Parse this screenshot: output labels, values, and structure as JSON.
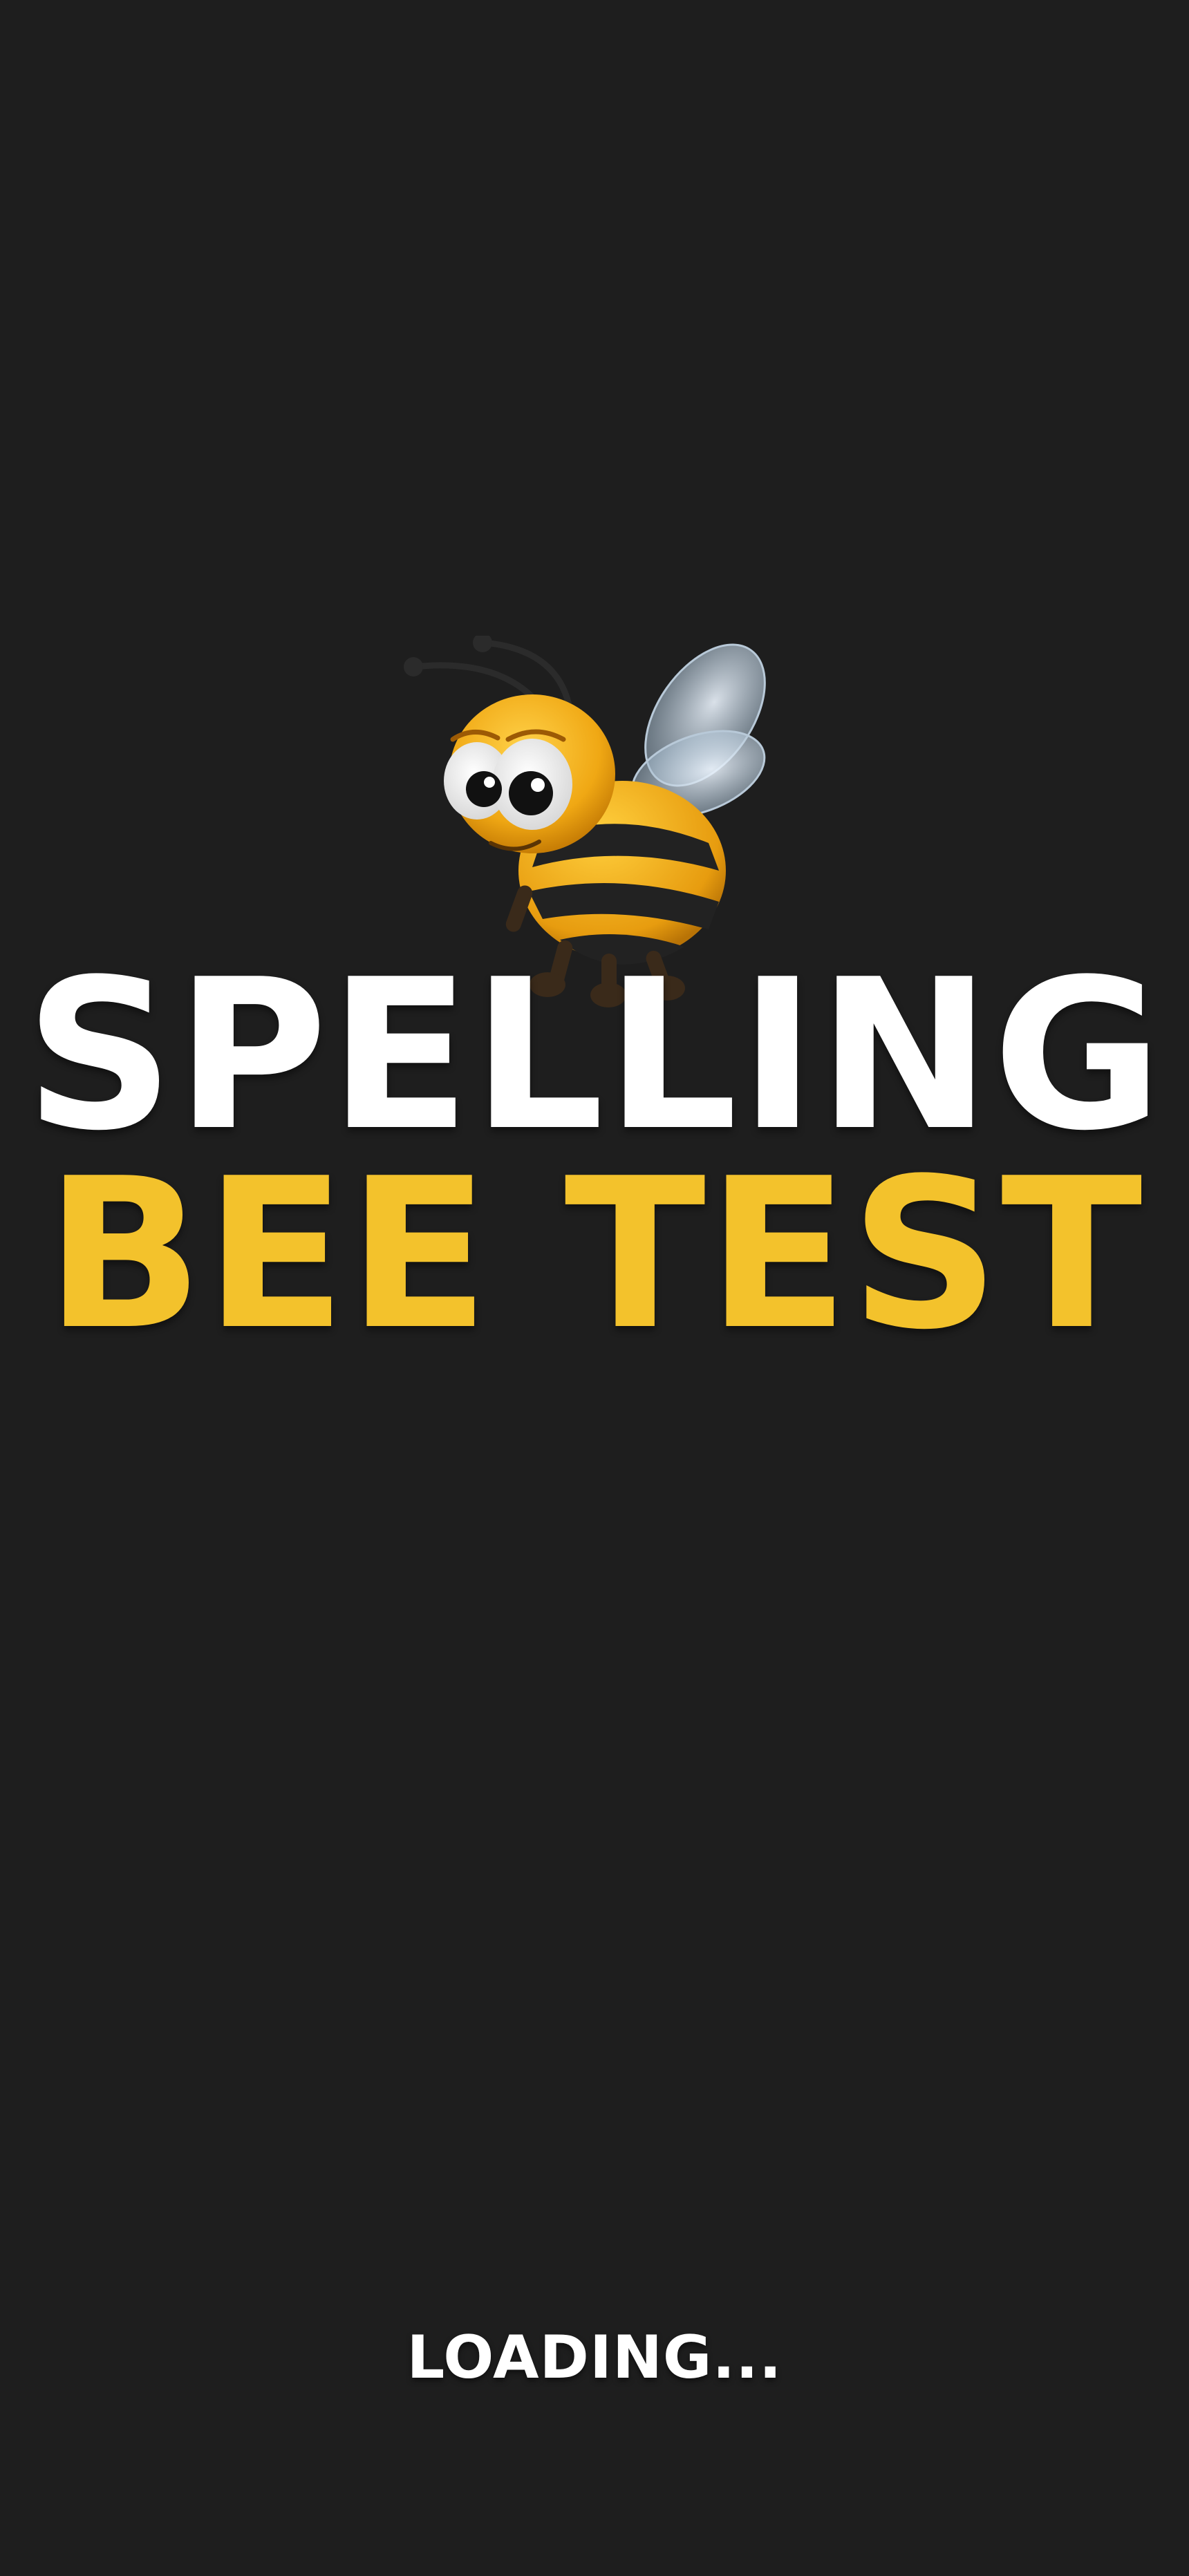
{
  "splash": {
    "title_line1": "SPELLING",
    "title_line2": "BEE TEST",
    "loading_text": "LOADING...",
    "mascot_icon": "bee-mascot-icon"
  },
  "colors": {
    "background": "#1e1e1e",
    "title_primary": "#ffffff",
    "title_accent": "#f3c22c"
  }
}
